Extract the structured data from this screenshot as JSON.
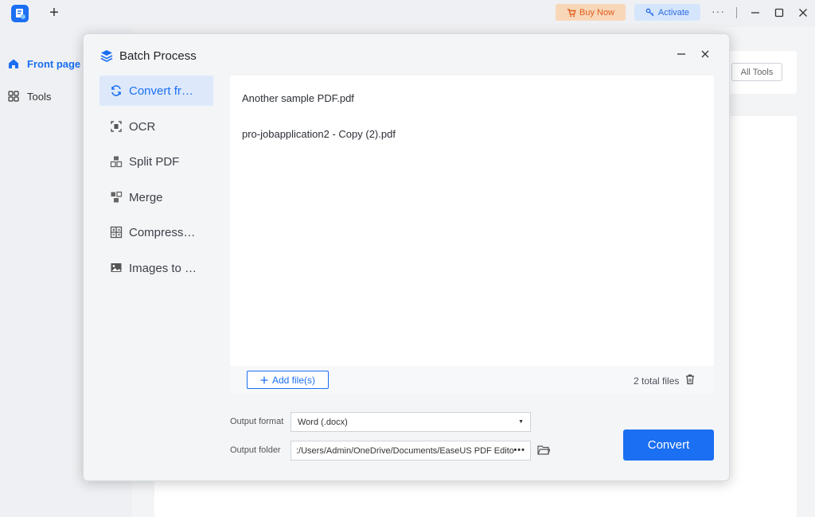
{
  "titlebar": {
    "buy_label": "Buy Now",
    "activate_label": "Activate"
  },
  "nav": {
    "front_page": "Front page",
    "tools": "Tools"
  },
  "background": {
    "all_tools_label": "All Tools"
  },
  "modal": {
    "title": "Batch Process",
    "sidebar": [
      {
        "label": "Convert fr…",
        "icon": "convert-icon"
      },
      {
        "label": "OCR",
        "icon": "ocr-icon"
      },
      {
        "label": "Split PDF",
        "icon": "split-icon"
      },
      {
        "label": "Merge",
        "icon": "merge-icon"
      },
      {
        "label": "Compress…",
        "icon": "compress-icon"
      },
      {
        "label": "Images to …",
        "icon": "image-icon"
      }
    ],
    "files": [
      "Another sample PDF.pdf",
      "pro-jobapplication2 - Copy (2).pdf"
    ],
    "add_files_label": "Add file(s)",
    "total_files": "2 total files",
    "output_format_label": "Output format",
    "output_format_value": "Word (.docx)",
    "output_folder_label": "Output folder",
    "output_folder_value": ":/Users/Admin/OneDrive/Documents/EaseUS PDF Editor",
    "convert_label": "Convert"
  },
  "colors": {
    "accent": "#1a6ff2",
    "buy_text": "#e25b1c",
    "buy_bg": "#f8d7b8",
    "activate_bg": "#d5e5fc"
  }
}
